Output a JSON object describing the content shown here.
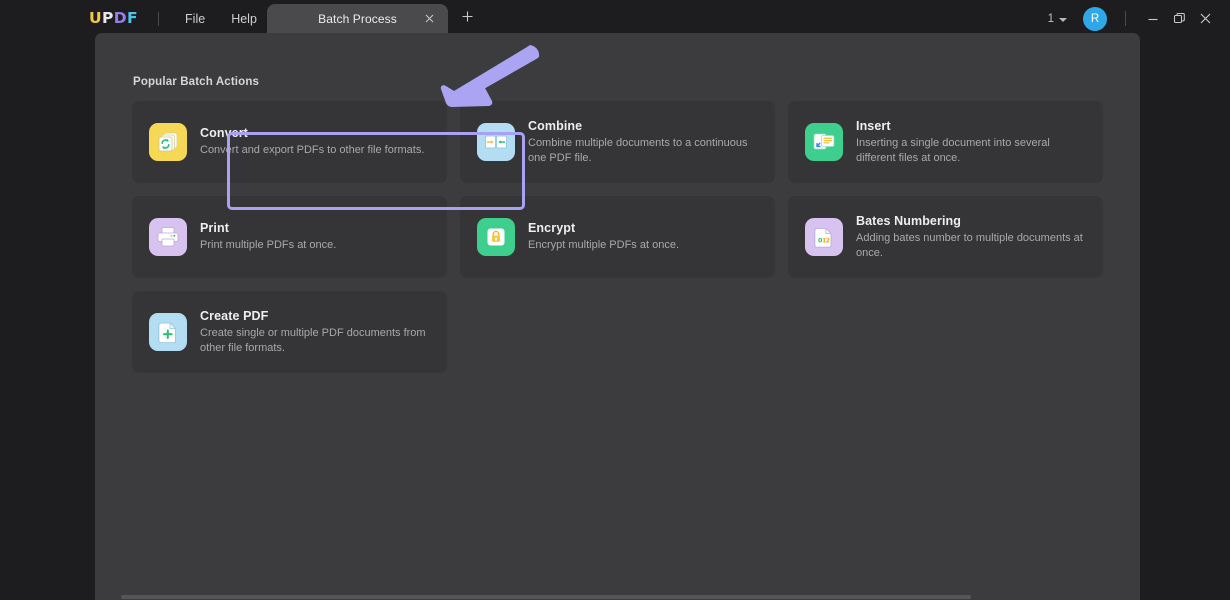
{
  "titlebar": {
    "logo": {
      "u": "U",
      "p": "P",
      "d": "D",
      "f": "F"
    },
    "menu": [
      {
        "label": "File",
        "name": "menu-file"
      },
      {
        "label": "Help",
        "name": "menu-help"
      }
    ],
    "tab": {
      "label": "Batch Process",
      "close_icon": "close-icon",
      "new_tab_icon": "plus-icon"
    },
    "page_count": "1",
    "page_count_icon": "chevron-down-icon",
    "avatar_initial": "R",
    "avatar_color": "#2fa8e8",
    "window_controls": [
      {
        "name": "minimize-button",
        "icon": "minimize-icon"
      },
      {
        "name": "maximize-button",
        "icon": "restore-icon"
      },
      {
        "name": "close-button",
        "icon": "close-icon"
      }
    ]
  },
  "main": {
    "section_title": "Popular Batch Actions",
    "highlight_color": "#a9a2f2",
    "arrow_color": "#aba4f2",
    "cards": [
      {
        "title": "Convert",
        "desc": "Convert and export PDFs to other file formats.",
        "icon": "convert-icon",
        "icon_bg": "#f5d854",
        "name": "card-convert",
        "highlighted": true
      },
      {
        "title": "Combine",
        "desc": "Combine multiple documents to a continuous one PDF file.",
        "icon": "combine-icon",
        "icon_bg": "#b3ddf2",
        "name": "card-combine",
        "highlighted": false
      },
      {
        "title": "Insert",
        "desc": "Inserting a single document into several different files at once.",
        "icon": "insert-icon",
        "icon_bg": "#3ecf8e",
        "name": "card-insert",
        "highlighted": false
      },
      {
        "title": "Print",
        "desc": "Print multiple PDFs at once.",
        "icon": "print-icon",
        "icon_bg": "#d7c2f0",
        "name": "card-print",
        "highlighted": false
      },
      {
        "title": "Encrypt",
        "desc": "Encrypt multiple PDFs at once.",
        "icon": "encrypt-icon",
        "icon_bg": "#3ecf8e",
        "name": "card-encrypt",
        "highlighted": false
      },
      {
        "title": "Bates Numbering",
        "desc": "Adding bates number to multiple documents at once.",
        "icon": "bates-numbering-icon",
        "icon_bg": "#d7c2f0",
        "name": "card-bates-numbering",
        "highlighted": false
      },
      {
        "title": "Create PDF",
        "desc": "Create single or multiple PDF documents from other file formats.",
        "icon": "create-pdf-icon",
        "icon_bg": "#b3ddf2",
        "name": "card-create-pdf",
        "highlighted": false
      }
    ]
  }
}
